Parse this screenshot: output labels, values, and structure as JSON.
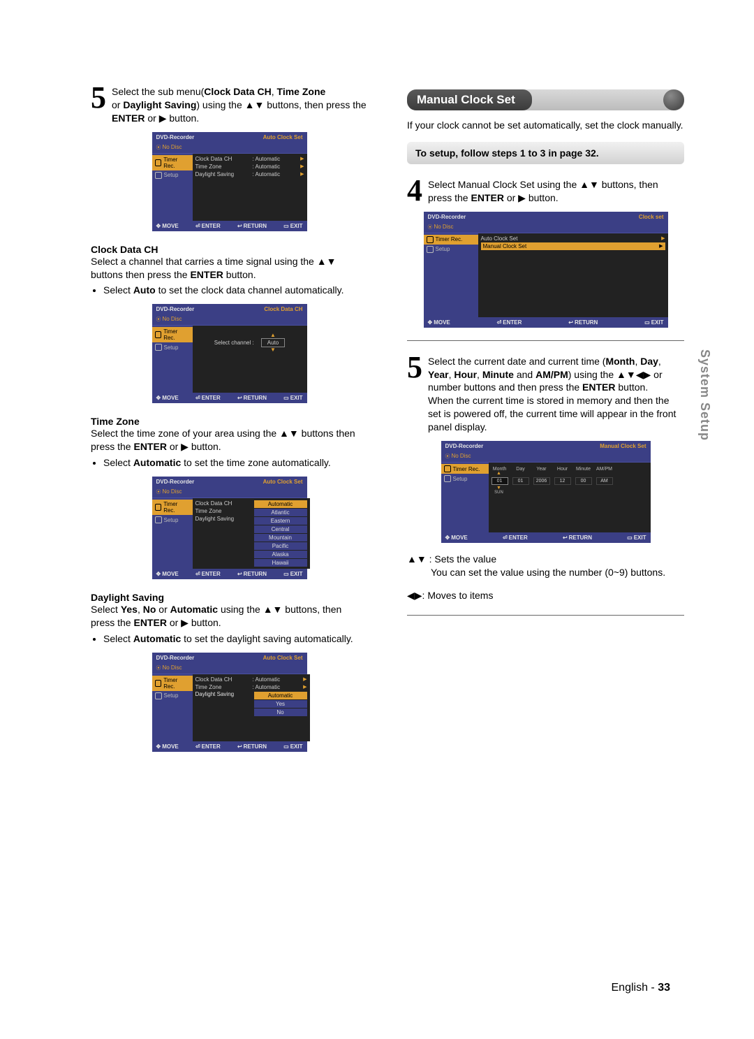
{
  "sideTab": "System Setup",
  "footer": {
    "lang": "English - ",
    "page": "33"
  },
  "left": {
    "step5": {
      "num": "5",
      "text_pre": "Select the sub menu(",
      "b1": "Clock Data CH",
      "sep1": ", ",
      "b2": "Time Zone",
      "line2_pre": " or ",
      "b3": "Daylight Saving",
      "line2_mid": ") using the ",
      "arrows": "▲▼",
      "line2_post": " buttons, then press the ",
      "b_enter": "ENTER",
      "line2_or": " or ",
      "arrow_r": "▶",
      "line2_end": " button."
    },
    "clockDataCH": {
      "head": "Clock Data CH",
      "p1a": "Select a channel that carries a time signal using the ",
      "p1arrows": "▲▼",
      "p1b": " buttons then press the ",
      "p1enter": "ENTER",
      "p1c": " button.",
      "bullet_pre": "Select ",
      "bullet_b": "Auto",
      "bullet_post": " to set the clock data channel automatically."
    },
    "timeZone": {
      "head": "Time Zone",
      "p1a": "Select the time zone of your area using the ",
      "p1arrows": "▲▼",
      "p1b": " buttons then press the ",
      "p1enter": "ENTER",
      "p1or": " or ",
      "p1arrow_r": "▶",
      "p1c": " button.",
      "bullet_pre": "Select ",
      "bullet_b": "Automatic",
      "bullet_post": " to set the time zone automatically."
    },
    "daylight": {
      "head": "Daylight Saving",
      "p1a": "Select ",
      "b1": "Yes",
      "sep1": ", ",
      "b2": "No",
      "sep_or": " or ",
      "b3": "Automatic",
      "p1b": " using the ",
      "p1arrows": "▲▼",
      "p1c": " buttons, then press the ",
      "p1enter": "ENTER",
      "p1or": " or ",
      "p1arrow_r": "▶",
      "p1d": " button.",
      "bullet_pre": "Select ",
      "bullet_b": "Automatic",
      "bullet_post": " to set the daylight saving automatically."
    }
  },
  "right": {
    "sectionTitle": "Manual Clock Set",
    "intro": "If your clock cannot be set automatically, set the clock manually.",
    "followBar": "To setup, follow steps 1 to 3 in page 32.",
    "step4": {
      "num": "4",
      "a": "Select Manual Clock Set using the ",
      "arrows": "▲▼",
      "b": " buttons, then press the ",
      "enter": "ENTER",
      "or": " or ",
      "arrow_r": "▶",
      "c": " button."
    },
    "step5": {
      "num": "5",
      "l1a": "Select the current date and current time (",
      "b1": "Month",
      "sep1": ", ",
      "l2b1": "Day",
      "sep2": ", ",
      "l2b2": "Year",
      "sep3": ", ",
      "l2b3": "Hour",
      "sep4": ", ",
      "l2b4": "Minute",
      "and": " and ",
      "l2b5": "AM/PM",
      "l2c": ") using the ",
      "l3arrows": "▲▼◀▶",
      "l3a": " or number buttons and then press the ",
      "l4enter": "ENTER",
      "l4a": " button.",
      "p2": "When the current time is stored in memory and then the set is powered off, the current time will appear in the front panel display."
    },
    "notes": {
      "n1arrows": "▲▼",
      "n1a": " : Sets the value",
      "n1b": "You can set the value using the number (0~9) buttons.",
      "n2arrows": "◀▶",
      "n2a": ": Moves to items"
    }
  },
  "osd": {
    "recorder": "DVD-Recorder",
    "noDisc": "No Disc",
    "sideTimer": "Timer Rec.",
    "sideSetup": "Setup",
    "foot_move": "MOVE",
    "foot_enter": "ENTER",
    "foot_return": "RETURN",
    "foot_exit": "EXIT",
    "foot_sym_move": "✥",
    "foot_sym_enter": "⏎",
    "foot_sym_return": "↩",
    "foot_sym_exit": "▭",
    "screen1": {
      "title_r": "Auto Clock Set",
      "rows": [
        {
          "label": "Clock Data CH",
          "val": ": Automatic"
        },
        {
          "label": "Time Zone",
          "val": ": Automatic"
        },
        {
          "label": "Daylight Saving",
          "val": ": Automatic"
        }
      ]
    },
    "screen2": {
      "title_r": "Clock Data CH",
      "label": "Select channel :",
      "val": "Auto"
    },
    "screen3": {
      "title_r": "Auto Clock Set",
      "rows": [
        {
          "label": "Clock Data CH",
          "val": "Automatic",
          "active": true
        },
        {
          "label": "Time Zone",
          "val": "Atlantic"
        },
        {
          "label": "Daylight Saving",
          "val": "Eastern"
        }
      ],
      "extra": [
        "Central",
        "Mountain",
        "Pacific",
        "Alaska",
        "Hawaii"
      ]
    },
    "screen4": {
      "title_r": "Auto Clock Set",
      "rows": [
        {
          "label": "Clock Data CH",
          "val": ": Automatic"
        },
        {
          "label": "Time Zone",
          "val": ": Automatic"
        }
      ],
      "ds_label": "Daylight Saving",
      "opts": [
        "Automatic",
        "Yes",
        "No"
      ],
      "opt_active": 0
    },
    "screen5": {
      "title_r": "Clock set",
      "items": [
        {
          "label": "Auto Clock Set"
        },
        {
          "label": "Manual Clock Set"
        }
      ]
    },
    "screen6": {
      "title_r": "Manual Clock Set",
      "headers": [
        "Month",
        "Day",
        "Year",
        "Hour",
        "Minute",
        "AM/PM"
      ],
      "values": [
        "01",
        "01",
        "2006",
        "12",
        "00",
        "AM"
      ],
      "sub": "SUN"
    }
  }
}
